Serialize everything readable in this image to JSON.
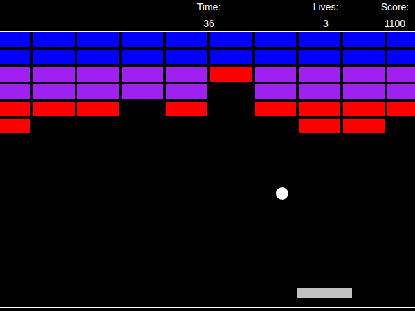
{
  "hud": [
    {
      "label": "Time:",
      "value": "36"
    },
    {
      "label": "Lives:",
      "value": "3"
    },
    {
      "label": "Score:",
      "value": "1100"
    }
  ],
  "bricks": [
    [
      {
        "present": true,
        "color": "#0000ff"
      },
      {
        "present": true,
        "color": "#0000ff"
      },
      {
        "present": true,
        "color": "#0000ff"
      },
      {
        "present": true,
        "color": "#0000ff"
      },
      {
        "present": true,
        "color": "#0000ff"
      },
      {
        "present": true,
        "color": "#0000ff"
      },
      {
        "present": true,
        "color": "#0000ff"
      },
      {
        "present": true,
        "color": "#0000ff"
      },
      {
        "present": true,
        "color": "#0000ff"
      },
      {
        "present": true,
        "color": "#0000ff"
      }
    ],
    [
      {
        "present": true,
        "color": "#0000ff"
      },
      {
        "present": true,
        "color": "#0000ff"
      },
      {
        "present": true,
        "color": "#0000ff"
      },
      {
        "present": true,
        "color": "#0000ff"
      },
      {
        "present": true,
        "color": "#0000ff"
      },
      {
        "present": true,
        "color": "#0000ff"
      },
      {
        "present": true,
        "color": "#0000ff"
      },
      {
        "present": true,
        "color": "#0000ff"
      },
      {
        "present": true,
        "color": "#0000ff"
      },
      {
        "present": true,
        "color": "#0000ff"
      }
    ],
    [
      {
        "present": true,
        "color": "#a020f0"
      },
      {
        "present": true,
        "color": "#a020f0"
      },
      {
        "present": true,
        "color": "#a020f0"
      },
      {
        "present": true,
        "color": "#a020f0"
      },
      {
        "present": true,
        "color": "#a020f0"
      },
      {
        "present": true,
        "color": "#ff0000"
      },
      {
        "present": true,
        "color": "#a020f0"
      },
      {
        "present": true,
        "color": "#a020f0"
      },
      {
        "present": true,
        "color": "#a020f0"
      },
      {
        "present": true,
        "color": "#a020f0"
      }
    ],
    [
      {
        "present": true,
        "color": "#a020f0"
      },
      {
        "present": true,
        "color": "#a020f0"
      },
      {
        "present": true,
        "color": "#a020f0"
      },
      {
        "present": true,
        "color": "#a020f0"
      },
      {
        "present": true,
        "color": "#a020f0"
      },
      {
        "present": false
      },
      {
        "present": true,
        "color": "#a020f0"
      },
      {
        "present": true,
        "color": "#a020f0"
      },
      {
        "present": true,
        "color": "#a020f0"
      },
      {
        "present": true,
        "color": "#a020f0"
      }
    ],
    [
      {
        "present": true,
        "color": "#ff0000"
      },
      {
        "present": true,
        "color": "#ff0000"
      },
      {
        "present": true,
        "color": "#ff0000"
      },
      {
        "present": false
      },
      {
        "present": true,
        "color": "#ff0000"
      },
      {
        "present": false
      },
      {
        "present": true,
        "color": "#ff0000"
      },
      {
        "present": true,
        "color": "#ff0000"
      },
      {
        "present": true,
        "color": "#ff0000"
      },
      {
        "present": true,
        "color": "#ff0000"
      }
    ],
    [
      {
        "present": true,
        "color": "#ff0000"
      },
      {
        "present": false
      },
      {
        "present": false
      },
      {
        "present": false
      },
      {
        "present": false
      },
      {
        "present": false
      },
      {
        "present": false
      },
      {
        "present": true,
        "color": "#ff0000"
      },
      {
        "present": true,
        "color": "#ff0000"
      },
      {
        "present": false
      }
    ]
  ]
}
